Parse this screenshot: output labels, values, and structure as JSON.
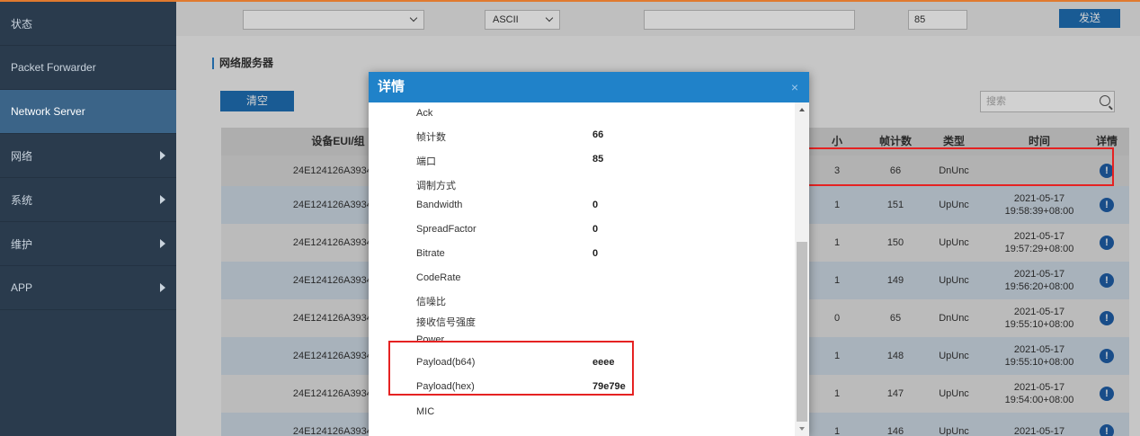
{
  "sidebar": {
    "items": [
      {
        "label": "状态",
        "arrow": false
      },
      {
        "label": "Packet Forwarder",
        "arrow": false
      },
      {
        "label": "Network Server",
        "arrow": false,
        "active": true
      },
      {
        "label": "网络",
        "arrow": true
      },
      {
        "label": "系统",
        "arrow": true
      },
      {
        "label": "维护",
        "arrow": true
      },
      {
        "label": "APP",
        "arrow": true
      }
    ]
  },
  "sendbar": {
    "device_select_value": "",
    "encoding_select_value": "ASCII",
    "payload_value": "",
    "port_value": "85",
    "send_label": "发送"
  },
  "section": {
    "title": "网络服务器",
    "clear_label": "清空",
    "search_placeholder": "搜索"
  },
  "table": {
    "headers": {
      "eui": "设备EUI/组",
      "size": "小",
      "fcnt": "帧计数",
      "type": "类型",
      "time": "时间",
      "details": "详情"
    },
    "rows": [
      {
        "eui": "24E124126A393471",
        "size": "3",
        "fcnt": "66",
        "type": "DnUnc",
        "time": ""
      },
      {
        "eui": "24E124126A393471",
        "size": "1",
        "fcnt": "151",
        "type": "UpUnc",
        "time": "2021-05-17 19:58:39+08:00"
      },
      {
        "eui": "24E124126A393471",
        "size": "1",
        "fcnt": "150",
        "type": "UpUnc",
        "time": "2021-05-17 19:57:29+08:00"
      },
      {
        "eui": "24E124126A393471",
        "size": "1",
        "fcnt": "149",
        "type": "UpUnc",
        "time": "2021-05-17 19:56:20+08:00"
      },
      {
        "eui": "24E124126A393471",
        "size": "0",
        "fcnt": "65",
        "type": "DnUnc",
        "time": "2021-05-17 19:55:10+08:00"
      },
      {
        "eui": "24E124126A393471",
        "size": "1",
        "fcnt": "148",
        "type": "UpUnc",
        "time": "2021-05-17 19:55:10+08:00"
      },
      {
        "eui": "24E124126A393471",
        "size": "1",
        "fcnt": "147",
        "type": "UpUnc",
        "time": "2021-05-17 19:54:00+08:00"
      },
      {
        "eui": "24E124126A393471",
        "size": "1",
        "fcnt": "146",
        "type": "UpUnc",
        "time": "2021-05-17"
      }
    ]
  },
  "modal": {
    "title": "详情",
    "close_glyph": "×",
    "fields": [
      {
        "label": "Ack",
        "value": ""
      },
      {
        "label": "帧计数",
        "value": "66"
      },
      {
        "label": "端口",
        "value": "85"
      },
      {
        "label": "调制方式",
        "value": ""
      },
      {
        "label": "Bandwidth",
        "value": "0"
      },
      {
        "label": "SpreadFactor",
        "value": "0"
      },
      {
        "label": "Bitrate",
        "value": "0"
      },
      {
        "label": "CodeRate",
        "value": ""
      },
      {
        "label": "信噪比",
        "value": ""
      },
      {
        "label": "接收信号强度",
        "value": ""
      },
      {
        "label": "Power",
        "value": ""
      },
      {
        "label": "Payload(b64)",
        "value": "eeee"
      },
      {
        "label": "Payload(hex)",
        "value": "79e79e"
      },
      {
        "label": "MIC",
        "value": ""
      }
    ]
  },
  "colors": {
    "sidebar_bg": "#2a3b4d",
    "sidebar_active": "#3b6488",
    "modal_header": "#2082c9",
    "accent_button": "#1f6fb5",
    "highlight_red": "#e52222",
    "info_icon": "#1f5fa8"
  }
}
